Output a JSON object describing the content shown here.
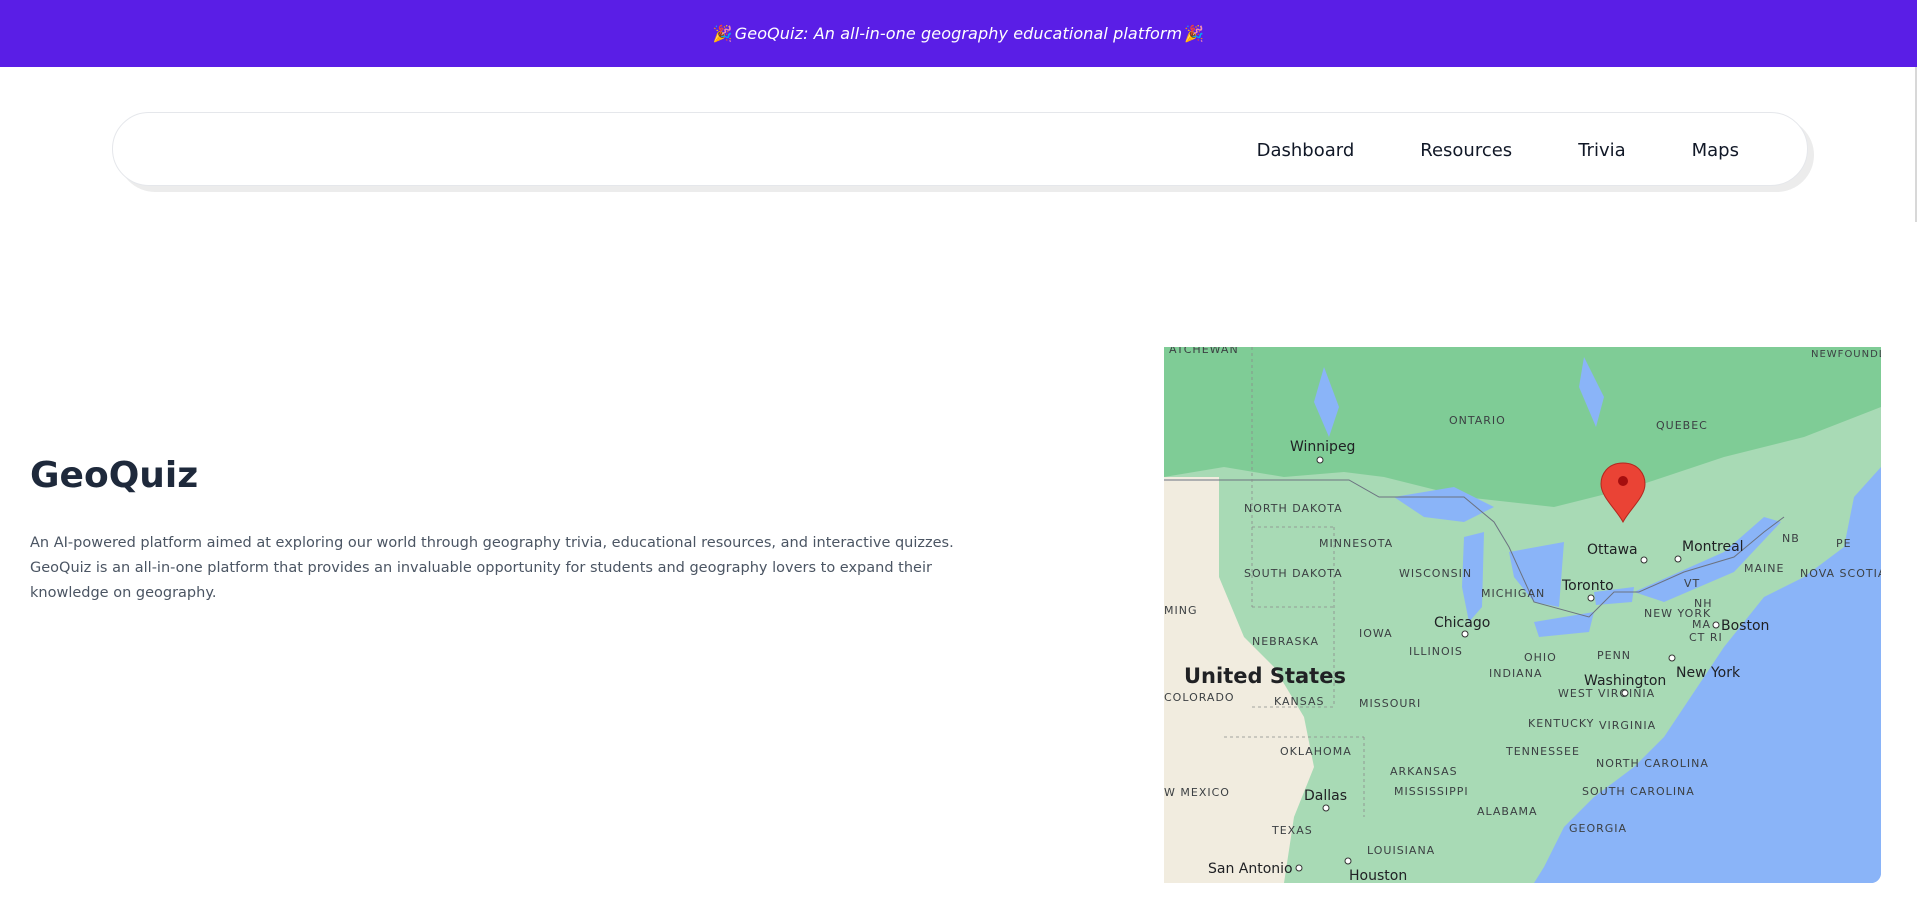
{
  "banner": {
    "text": "GeoQuiz: An all-in-one geography educational platform",
    "emoji": "🎉"
  },
  "nav": {
    "items": [
      "Dashboard",
      "Resources",
      "Trivia",
      "Maps"
    ]
  },
  "hero": {
    "title": "GeoQuiz",
    "description": "An AI-powered platform aimed at exploring our world through geography trivia, educational resources, and interactive quizzes. GeoQuiz is an all-in-one platform that provides an invaluable opportunity for students and geography lovers to expand their knowledge on geography."
  },
  "map": {
    "country_label": "United States",
    "cities": [
      "Winnipeg",
      "Ottawa",
      "Montreal",
      "Toronto",
      "Chicago",
      "Boston",
      "New York",
      "Washington",
      "Dallas",
      "San Antonio",
      "Houston"
    ],
    "regions": [
      "ATCHEWAN",
      "ONTARIO",
      "QUEBEC",
      "NEWFOUNDLAND AND LABR",
      "NORTH DAKOTA",
      "MINNESOTA",
      "SOUTH DAKOTA",
      "WISCONSIN",
      "MICHIGAN",
      "NEBRASKA",
      "IOWA",
      "ILLINOIS",
      "INDIANA",
      "OHIO",
      "PENN",
      "NEW YORK",
      "VT",
      "NH",
      "MA",
      "CT RI",
      "MAINE",
      "NB",
      "PE",
      "NOVA SCOTIA",
      "KANSAS",
      "MISSOURI",
      "KENTUCKY",
      "WEST VIRGINIA",
      "VIRGINIA",
      "OKLAHOMA",
      "ARKANSAS",
      "TENNESSEE",
      "NORTH CAROLINA",
      "MISSISSIPPI",
      "ALABAMA",
      "SOUTH CAROLINA",
      "GEORGIA",
      "TEXAS",
      "LOUISIANA",
      "COLORADO",
      "MING",
      "W MEXICO"
    ],
    "colors": {
      "land": "#a8dab5",
      "forest": "#7fcc96",
      "water": "#8ab4f8",
      "desert": "#f1ecdf",
      "marker": "#ea4335"
    }
  }
}
